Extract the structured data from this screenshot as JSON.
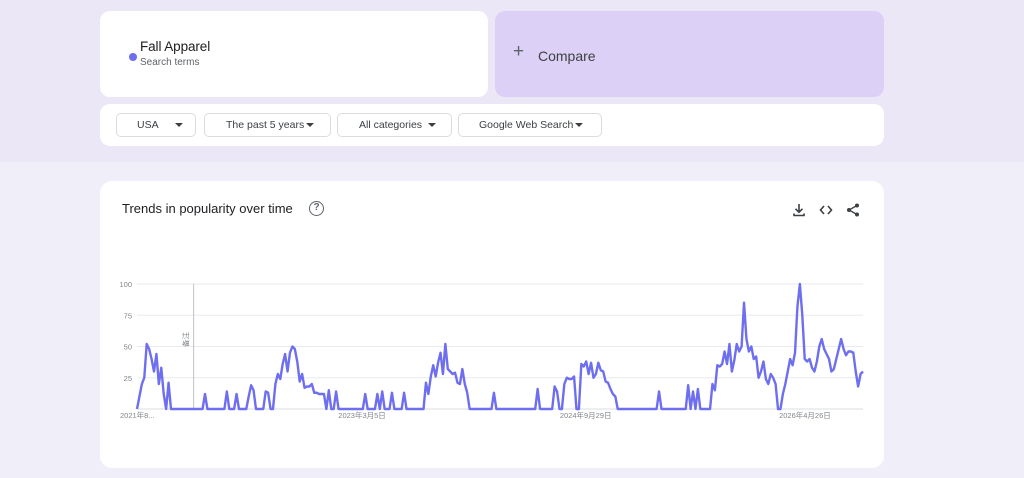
{
  "search": {
    "term_name": "Fall Apparel",
    "term_subtitle": "Search terms",
    "term_color": "#6e6ef0",
    "compare_label": "Compare"
  },
  "filters": {
    "region": "USA",
    "time_range": "The past 5 years",
    "category": "All categories",
    "search_type": "Google Web Search"
  },
  "chart_card": {
    "title": "Trends in popularity over time",
    "icons": [
      "help-icon",
      "download-icon",
      "embed-code-icon",
      "share-icon"
    ]
  },
  "chart_data": {
    "type": "line",
    "title": "Trends in popularity over time",
    "ylim": [
      0,
      100
    ],
    "y_ticks": [
      "100",
      "75",
      "50",
      "25"
    ],
    "x_tick_labels": [
      "2021年8...",
      "2023年3月5日",
      "2024年9月29日",
      "2026年4月26日"
    ],
    "annotation": "备注",
    "grid": true,
    "series": [
      {
        "color": "#6e6ef0",
        "values": [
          0,
          10,
          20,
          25,
          52,
          48,
          40,
          30,
          44,
          20,
          33,
          12,
          0,
          21,
          0,
          0,
          0,
          0,
          0,
          0,
          0,
          0,
          0,
          0,
          0,
          0,
          0,
          0,
          12,
          0,
          0,
          0,
          0,
          0,
          0,
          0,
          0,
          14,
          0,
          0,
          0,
          12,
          0,
          0,
          0,
          0,
          10,
          19,
          15,
          0,
          0,
          0,
          0,
          14,
          13,
          0,
          0,
          20,
          28,
          24,
          36,
          44,
          30,
          45,
          50,
          48,
          38,
          22,
          28,
          17,
          18,
          18,
          20,
          13,
          13,
          12,
          12,
          12,
          0,
          15,
          0,
          0,
          14,
          0,
          0,
          0,
          0,
          0,
          0,
          0,
          0,
          0,
          0,
          0,
          12,
          0,
          0,
          0,
          0,
          12,
          0,
          14,
          0,
          0,
          0,
          13,
          0,
          0,
          0,
          0,
          13,
          0,
          0,
          0,
          0,
          0,
          0,
          0,
          0,
          21,
          12,
          26,
          35,
          26,
          37,
          45,
          28,
          52,
          32,
          30,
          28,
          29,
          21,
          20,
          32,
          20,
          13,
          0,
          0,
          0,
          0,
          0,
          0,
          0,
          0,
          0,
          0,
          13,
          0,
          0,
          0,
          0,
          0,
          0,
          0,
          0,
          0,
          0,
          0,
          0,
          0,
          0,
          0,
          0,
          0,
          16,
          0,
          0,
          0,
          0,
          0,
          0,
          18,
          14,
          0,
          0,
          20,
          25,
          24,
          24,
          26,
          0,
          0,
          36,
          34,
          38,
          28,
          37,
          25,
          28,
          37,
          31,
          30,
          22,
          21,
          16,
          12,
          10,
          0,
          0,
          0,
          0,
          0,
          0,
          0,
          0,
          0,
          0,
          0,
          0,
          0,
          0,
          0,
          0,
          0,
          14,
          0,
          0,
          0,
          0,
          0,
          0,
          0,
          0,
          0,
          0,
          0,
          19,
          0,
          14,
          0,
          16,
          0,
          0,
          0,
          0,
          0,
          20,
          15,
          35,
          34,
          36,
          46,
          36,
          52,
          30,
          39,
          52,
          46,
          50,
          85,
          56,
          46,
          50,
          40,
          42,
          25,
          30,
          38,
          24,
          20,
          28,
          25,
          20,
          0,
          0,
          12,
          20,
          30,
          40,
          35,
          45,
          82,
          100,
          75,
          40,
          38,
          40,
          33,
          30,
          38,
          50,
          56,
          48,
          44,
          40,
          30,
          32,
          40,
          48,
          56,
          48,
          43,
          46,
          46,
          45,
          30,
          18,
          28,
          30
        ]
      }
    ]
  }
}
